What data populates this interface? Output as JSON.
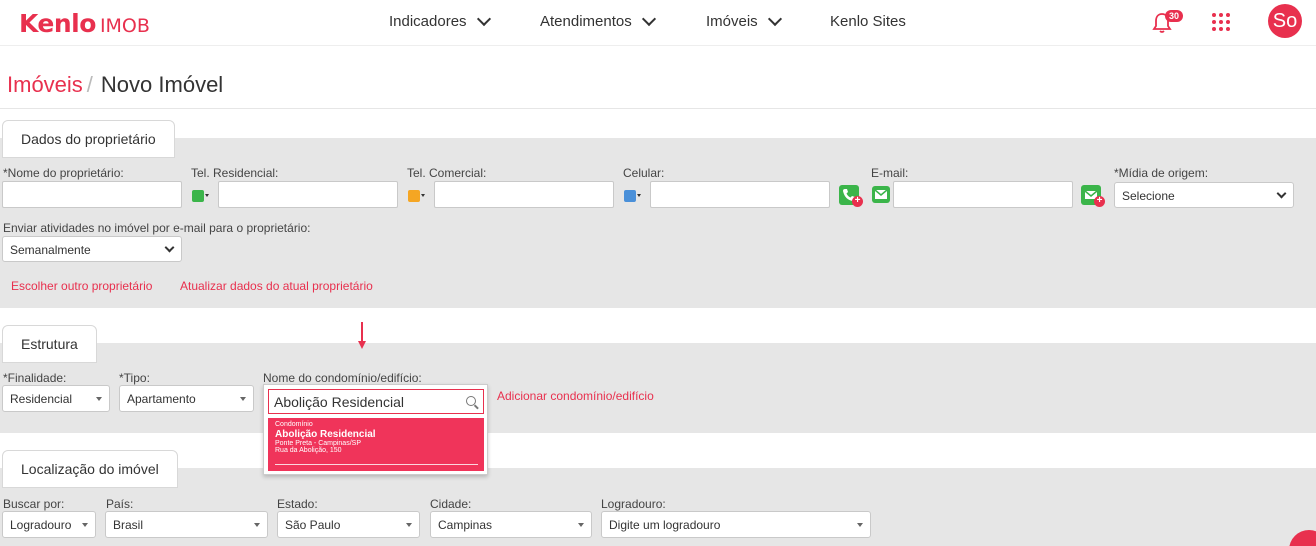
{
  "brand": {
    "name": "Kenlo",
    "product": "IMOB"
  },
  "nav": {
    "items": [
      "Indicadores",
      "Atendimentos",
      "Imóveis",
      "Kenlo Sites"
    ],
    "notifications": "30",
    "avatar": "So"
  },
  "breadcrumb": {
    "parent": "Imóveis",
    "separator": "/",
    "current": "Novo Imóvel"
  },
  "owner_section": {
    "title": "Dados do proprietário",
    "labels": {
      "name": "*Nome do proprietário:",
      "tel_res": "Tel. Residencial:",
      "tel_com": "Tel. Comercial:",
      "cel": "Celular:",
      "email": "E-mail:",
      "midia": "*Mídia de origem:"
    },
    "midia_value": "Selecione",
    "activity_label": "Enviar atividades no imóvel por e-mail para o proprietário:",
    "activity_value": "Semanalmente",
    "links": {
      "choose": "Escolher outro proprietário",
      "update": "Atualizar dados do atual proprietário"
    },
    "phone_colors": {
      "residencial": "#3bb54a",
      "comercial": "#f5a623",
      "celular": "#4a90d9"
    }
  },
  "structure_section": {
    "title": "Estrutura",
    "finalidade_label": "*Finalidade:",
    "finalidade_value": "Residencial",
    "tipo_label": "*Tipo:",
    "tipo_value": "Apartamento",
    "condo_label": "Nome do condomínio/edifício:",
    "condo_input": "Abolição Residencial",
    "add_condo": "Adicionar condomínio/edifício",
    "suggestion": {
      "category": "Condomínio",
      "name": "Abolição Residencial",
      "location": "Ponte Preta - Campinas/SP",
      "address": "Rua da Abolição, 150"
    }
  },
  "location_section": {
    "title": "Localização do imóvel",
    "fields": {
      "buscar": {
        "label": "Buscar por:",
        "value": "Logradouro"
      },
      "pais": {
        "label": "País:",
        "value": "Brasil"
      },
      "estado": {
        "label": "Estado:",
        "value": "São Paulo"
      },
      "cidade": {
        "label": "Cidade:",
        "value": "Campinas"
      },
      "logradouro": {
        "label": "Logradouro:",
        "value": "Digite um logradouro"
      }
    }
  },
  "colors": {
    "accent": "#e8304e",
    "section_bg": "#e6e6e6",
    "suggestion_bg": "#f0345a"
  }
}
